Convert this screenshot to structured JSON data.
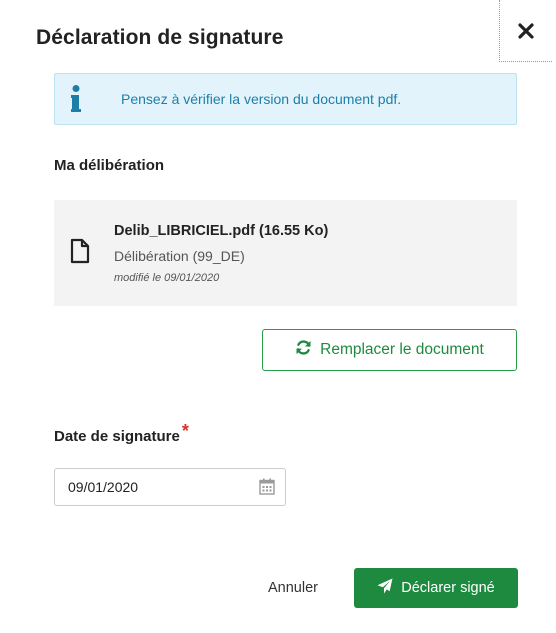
{
  "modal": {
    "title": "Déclaration de signature",
    "close_icon": "close-icon"
  },
  "info": {
    "icon": "info-icon",
    "text": "Pensez à vérifier la version du document pdf.",
    "color": "#1e7fa6",
    "background": "#e3f3fb"
  },
  "deliberation": {
    "section_label": "Ma délibération",
    "document": {
      "icon": "file-icon",
      "name": "Delib_LIBRICIEL.pdf (16.55 Ko)",
      "type": "Délibération (99_DE)",
      "modified": "modifié le 09/01/2020"
    },
    "replace_button": {
      "icon": "refresh-icon",
      "label": "Remplacer le document"
    }
  },
  "signature_date": {
    "label": "Date de signature",
    "required_mark": "*",
    "value": "09/01/2020",
    "icon": "calendar-icon"
  },
  "footer": {
    "cancel_label": "Annuler",
    "submit_label": "Déclarer signé",
    "submit_icon": "send-icon",
    "accent_color": "#1e8a3f"
  }
}
